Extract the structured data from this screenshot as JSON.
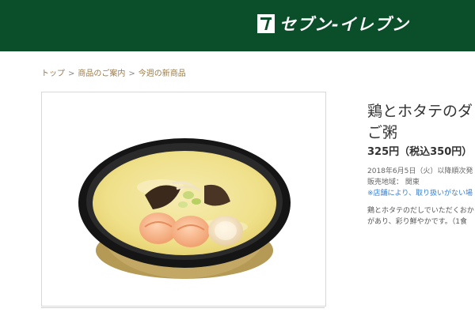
{
  "header": {
    "brand_text": "セブン-イレブン",
    "bg_color": "#0b4f2a"
  },
  "breadcrumb": {
    "items": [
      "トップ",
      "商品のご案内",
      "今週の新商品"
    ],
    "separator": ">"
  },
  "product": {
    "image_icon": "porridge-bowl-photo",
    "title_line1": "鶏とホタテのダ",
    "title_line2": "ご粥",
    "price": "325円（税込350円）",
    "release": "2018年6月5日（火）以降順次発",
    "area": "販売地域： 関東",
    "note": "※店舗により、取り扱いがない場",
    "desc_line1": "鶏とホタテのだしでいただくおか",
    "desc_line2": "があり、彩り鮮やかです。（1食"
  }
}
